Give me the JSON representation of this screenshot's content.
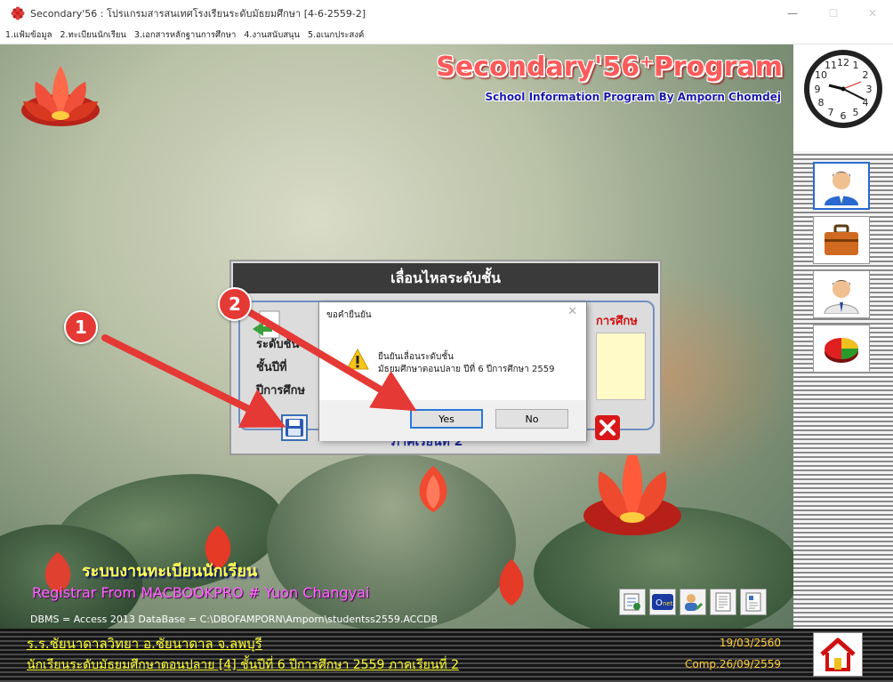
{
  "window": {
    "title": "Secondary'56 : โปรแกรมสารสนเทศโรงเรียนระดับมัธยมศึกษา [4-6-2559-2]",
    "minimize": "—",
    "maximize": "☐",
    "close": "✕"
  },
  "menu": [
    "1.แฟ้มข้อมูล",
    "2.ทะเบียนนักเรียน",
    "3.เอกสารหลักฐานการศึกษา",
    "4.งานสนับสนุน",
    "5.อเนกประสงค์"
  ],
  "brand": {
    "title": "Secondary'56⁺Program",
    "subtitle": "School Information Program By Amporn Chomdej"
  },
  "system_name": "ระบบงานทะเบียนนักเรียน",
  "registrar": "Registrar From MACBOOKPRO # Yuon Changyai",
  "dbms_line": "DBMS = Access 2013  DataBase = C:\\DBOFAMPORN\\Amporn\\studentss2559.ACCDB",
  "status": {
    "school": "ร.ร.ชัยนาดาลวิทยา  อ.ชัยนาดาล  จ.ลพบุรี",
    "student_level": "นักเรียนระดับมัธยมศึกษาตอนปลาย [4]  ชั้นปีที่ 6  ปีการศึกษา 2559  ภาคเรียนที่  2",
    "date": "19/03/2560",
    "comp": "Comp.26/09/2559"
  },
  "promote_dialog": {
    "title": "เลื่อนไหลระดับชั้น",
    "label_level": "ระดับชั้น",
    "label_grade": "ชั้นปีที่",
    "label_year": "ปีการศึกษ",
    "label_year_right": "การศึกษ",
    "semester_text": "ภาคเรียนที่ 2"
  },
  "confirm_dialog": {
    "title": "ขอคำยืนยัน",
    "message_line1": "ยืนยันเลื่อนระดับชั้น",
    "message_line2": "มัธยมศึกษาตอนปลาย ปีที่ 6 ปีการศึกษา 2559",
    "yes": "Yes",
    "no": "No"
  },
  "annotations": [
    "1",
    "2"
  ],
  "clock": {
    "numbers": [
      "12",
      "1",
      "2",
      "3",
      "4",
      "5",
      "6",
      "7",
      "8",
      "9",
      "10",
      "11"
    ]
  },
  "sidebar_icons": [
    "student-icon",
    "briefcase-icon",
    "teacher-icon",
    "pie-chart-icon"
  ],
  "toolbar_icons": [
    "certificate-icon",
    "onet-icon",
    "user-edit-icon",
    "document-icon",
    "report-icon"
  ],
  "colors": {
    "annotation_red": "#e53935",
    "status_text": "#ffff33",
    "brand_red": "#ff5a5a"
  }
}
